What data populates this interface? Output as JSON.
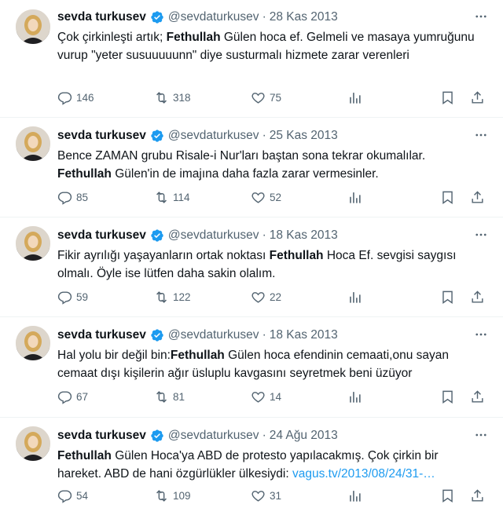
{
  "colors": {
    "text": "#0f1419",
    "muted": "#536471",
    "link": "#1d9bf0",
    "verified": "#1d9bf0"
  },
  "tweets": [
    {
      "name": "sevda turkusev",
      "handle": "@sevdaturkusev",
      "sep": "·",
      "date": "28 Kas 2013",
      "text_parts": [
        "Çok çirkinleşti artık; ",
        "Fethullah",
        " Gülen hoca ef. Gelmeli ve masaya yumruğunu vurup \"yeter susuuuuunn\" diye susturmalı hizmete zarar verenleri"
      ],
      "replies": "146",
      "retweets": "318",
      "likes": "75"
    },
    {
      "name": "sevda turkusev",
      "handle": "@sevdaturkusev",
      "sep": "·",
      "date": "25 Kas 2013",
      "text_parts": [
        "Bence ZAMAN grubu Risale-i Nur'ları baştan sona tekrar okumalılar.",
        "Fethullah",
        " Gülen'in de imajına daha fazla zarar vermesinler."
      ],
      "replies": "85",
      "retweets": "114",
      "likes": "52"
    },
    {
      "name": "sevda turkusev",
      "handle": "@sevdaturkusev",
      "sep": "·",
      "date": "18 Kas 2013",
      "text_parts": [
        "Fikir ayrılığı yaşayanların ortak noktası ",
        "Fethullah",
        " Hoca Ef. sevgisi saygısı olmalı. Öyle ise lütfen daha sakin olalım."
      ],
      "replies": "59",
      "retweets": "122",
      "likes": "22"
    },
    {
      "name": "sevda turkusev",
      "handle": "@sevdaturkusev",
      "sep": "·",
      "date": "18 Kas 2013",
      "text_parts": [
        "Hal yolu bir değil bin:",
        "Fethullah",
        " Gülen hoca efendinin cemaati,onu sayan cemaat dışı kişilerin ağır üsluplu  kavgasını seyretmek beni üzüyor"
      ],
      "replies": "67",
      "retweets": "81",
      "likes": "14"
    },
    {
      "name": "sevda turkusev",
      "handle": "@sevdaturkusev",
      "sep": "·",
      "date": "24 Ağu 2013",
      "text_parts": [
        "",
        "Fethullah",
        " Gülen Hoca'ya ABD de protesto yapılacakmış. Çok çirkin bir hareket. ABD de hani özgürlükler ülkesiydi: "
      ],
      "link": "vagus.tv/2013/08/24/31-…",
      "replies": "54",
      "retweets": "109",
      "likes": "31"
    }
  ]
}
